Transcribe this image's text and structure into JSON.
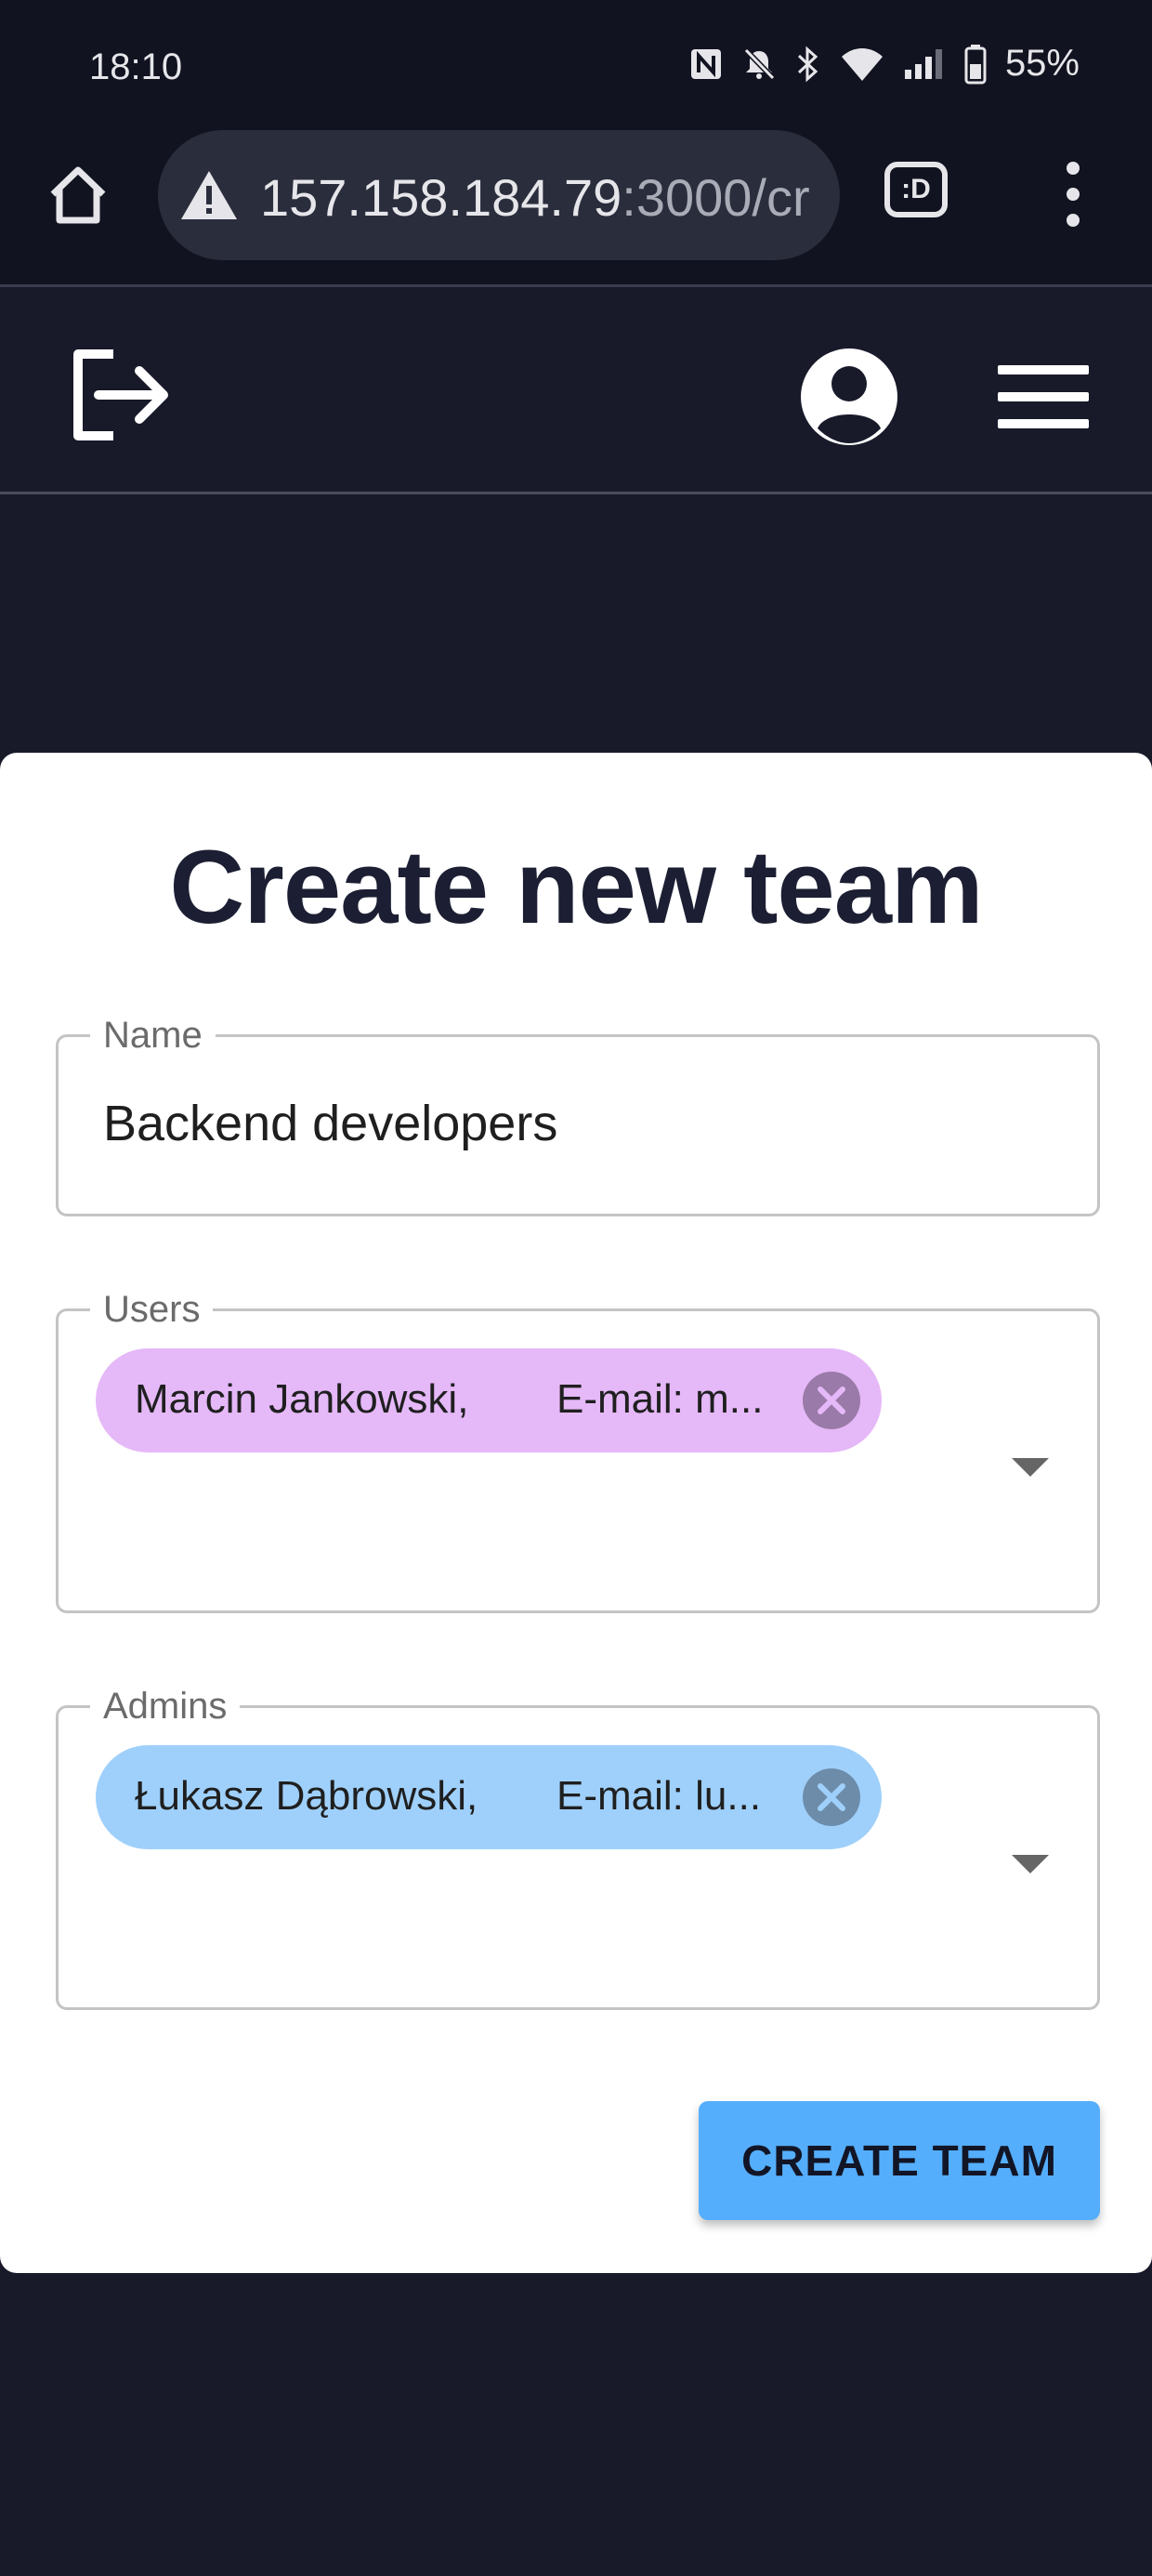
{
  "status_bar": {
    "time": "18:10",
    "battery": "55%",
    "icons": [
      "nfc-icon",
      "mute-icon",
      "bluetooth-icon",
      "wifi-icon",
      "signal-icon",
      "battery-icon"
    ]
  },
  "browser": {
    "url_host": "157.158.184.79",
    "url_rest": ":3000/cr",
    "tabs_label": ":D",
    "icons": [
      "home-icon",
      "warning-icon",
      "tabs-icon",
      "more-vert-icon"
    ]
  },
  "header": {
    "icons": [
      "logout-icon",
      "account-icon",
      "menu-icon"
    ]
  },
  "form": {
    "title": "Create new team",
    "name": {
      "label": "Name",
      "value": "Backend developers"
    },
    "users": {
      "label": "Users",
      "chips": [
        {
          "name": "Marcin Jankowski,",
          "email": "E-mail: m..."
        }
      ]
    },
    "admins": {
      "label": "Admins",
      "chips": [
        {
          "name": "Łukasz Dąbrowski,",
          "email": "E-mail: lu..."
        }
      ]
    },
    "submit_label": "CREATE TEAM"
  },
  "colors": {
    "background": "#181a2a",
    "card": "#ffffff",
    "user_chip": "#e5b8f8",
    "admin_chip": "#9fd0fb",
    "primary_button": "#55aefc",
    "title_text": "#1c1f33"
  }
}
